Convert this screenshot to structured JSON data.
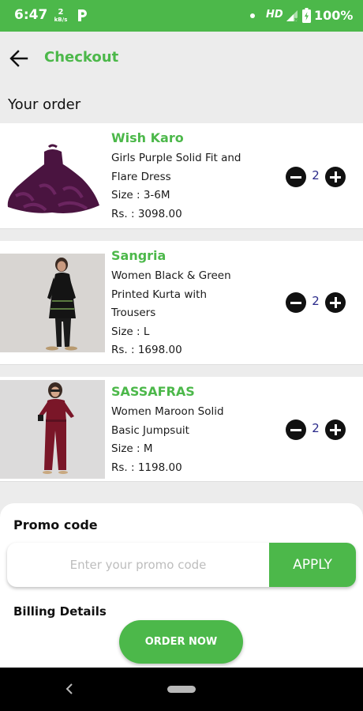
{
  "status_bar": {
    "time": "6:47",
    "net_speed_value": "2",
    "net_speed_unit": "kB/s",
    "network_type": "HD",
    "battery_percent": "100%"
  },
  "header": {
    "title": "Checkout"
  },
  "order": {
    "section_title": "Your order",
    "items": [
      {
        "brand": "Wish Karo",
        "name_lines": [
          "Girls Purple Solid Fit and",
          "Flare Dress"
        ],
        "size": "Size : 3-6M",
        "price": "Rs. : 3098.00",
        "quantity": "2"
      },
      {
        "brand": "Sangria",
        "name_lines": [
          "Women Black & Green",
          "Printed Kurta with",
          "Trousers"
        ],
        "size": "Size : L",
        "price": "Rs. : 1698.00",
        "quantity": "2"
      },
      {
        "brand": "SASSAFRAS",
        "name_lines": [
          "Women Maroon Solid",
          "Basic Jumpsuit"
        ],
        "size": "Size : M",
        "price": "Rs. : 1198.00",
        "quantity": "2"
      }
    ]
  },
  "promo": {
    "title": "Promo code",
    "placeholder": "Enter your promo code",
    "apply_label": "APPLY"
  },
  "billing": {
    "title": "Billing Details"
  },
  "order_now_label": "ORDER NOW",
  "colors": {
    "accent": "#4cb84a",
    "background": "#ececec",
    "quantity_text": "#2a2a8a"
  }
}
